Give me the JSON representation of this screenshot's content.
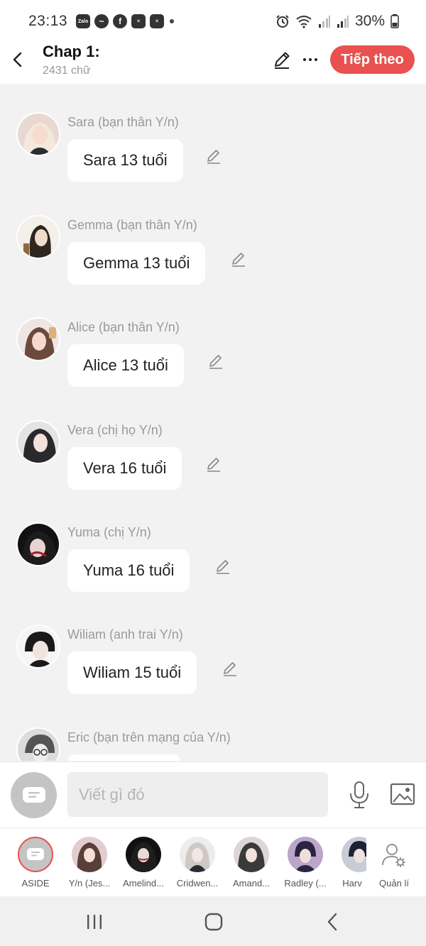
{
  "status_bar": {
    "time": "23:13",
    "app_icons": [
      "zalo-icon",
      "messenger-icon",
      "facebook-icon",
      "capcut-icon",
      "capcut-icon"
    ],
    "battery": "30%"
  },
  "header": {
    "title": "Chap 1:",
    "word_count": "2431 chữ",
    "next_label": "Tiếp theo",
    "accent_color": "#e8514f"
  },
  "messages": [
    {
      "sender": "Sara (bạn thân Y/n)",
      "text": "Sara 13 tuổi"
    },
    {
      "sender": "Gemma (bạn thân Y/n)",
      "text": "Gemma 13 tuổi"
    },
    {
      "sender": "Alice (bạn thân Y/n)",
      "text": "Alice 13 tuổi"
    },
    {
      "sender": "Vera (chị họ Y/n)",
      "text": "Vera 16 tuổi"
    },
    {
      "sender": "Yuma (chị Y/n)",
      "text": "Yuma 16 tuổi"
    },
    {
      "sender": "Wiliam (anh trai Y/n)",
      "text": "Wiliam 15 tuổi"
    },
    {
      "sender": "Eric (bạn trên mạng của Y/n)",
      "text": ""
    }
  ],
  "composer": {
    "placeholder": "Viết gì đó"
  },
  "characters": [
    {
      "label": "ASIDE"
    },
    {
      "label": "Y/n (Jes..."
    },
    {
      "label": "Amelind..."
    },
    {
      "label": "Cridwen..."
    },
    {
      "label": "Amand..."
    },
    {
      "label": "Radley (..."
    },
    {
      "label": "Harv"
    }
  ],
  "manage_label": "Quản lí"
}
